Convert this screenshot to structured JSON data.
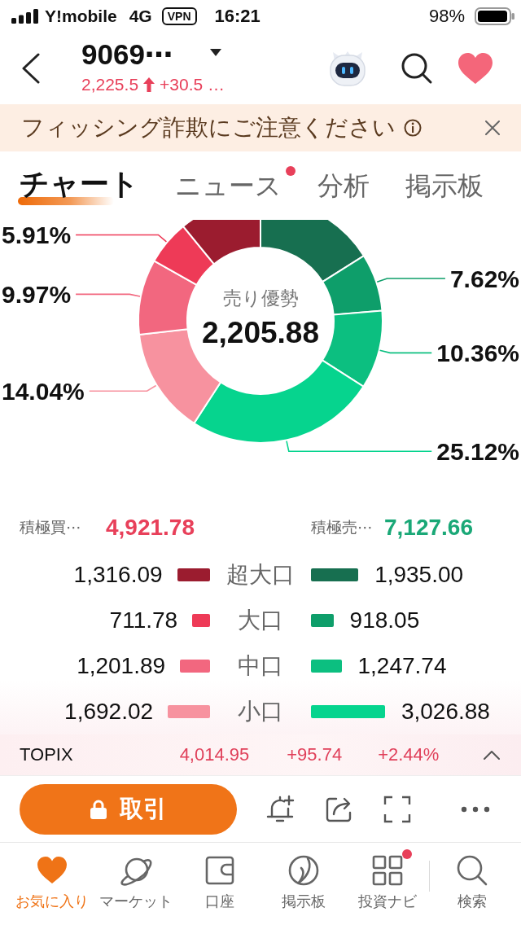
{
  "status_bar": {
    "carrier": "Y!mobile",
    "network": "4G",
    "vpn": "VPN",
    "time": "16:21",
    "battery": "98%"
  },
  "header": {
    "title": "9069⋯",
    "price": "2,225.5",
    "change": "+30.5 …"
  },
  "notice": {
    "text": "フィッシング詐欺にご注意ください"
  },
  "tabs": [
    {
      "label": "チャート",
      "selected": true,
      "dot": false
    },
    {
      "label": "ニュース",
      "selected": false,
      "dot": true
    },
    {
      "label": "分析",
      "selected": false,
      "dot": false
    },
    {
      "label": "掲示板",
      "selected": false,
      "dot": false
    }
  ],
  "chart": {
    "center_title": "売り優勢",
    "center_value": "2,205.88",
    "chart_data": {
      "type": "donut",
      "values": [
        16.06,
        7.62,
        10.36,
        25.12,
        14.04,
        9.97,
        5.91,
        10.92
      ],
      "value_labels": [
        null,
        "7.62%",
        "10.36%",
        "25.12%",
        "14.04%",
        "9.97%",
        "5.91%",
        null
      ]
    }
  },
  "summary": {
    "buy": {
      "label": "積極買⋯",
      "value": "4,921.78"
    },
    "sell": {
      "label": "積極売⋯",
      "value": "7,127.66"
    }
  },
  "flows": [
    {
      "label": "超大口",
      "buy": {
        "value": "1,316.09",
        "color": "#9b1c2f"
      },
      "sell": {
        "value": "1,935.00",
        "color": "#176f50"
      }
    },
    {
      "label": "大口",
      "buy": {
        "value": "711.78",
        "color": "#ee3a57"
      },
      "sell": {
        "value": "918.05",
        "color": "#0e9e6a"
      }
    },
    {
      "label": "中口",
      "buy": {
        "value": "1,201.89",
        "color": "#f2677f"
      },
      "sell": {
        "value": "1,247.74",
        "color": "#0cbf80"
      }
    },
    {
      "label": "小口",
      "buy": {
        "value": "1,692.02",
        "color": "#f7929f"
      },
      "sell": {
        "value": "3,026.88",
        "color": "#06d48e"
      }
    }
  ],
  "index_ticker": {
    "name": "TOPIX",
    "value": "4,014.95",
    "change": "+95.74",
    "percent": "+2.44%"
  },
  "actions": {
    "trade": "取引"
  },
  "nav": [
    {
      "label": "お気に入り",
      "selected": true,
      "dot": false
    },
    {
      "label": "マーケット",
      "selected": false,
      "dot": false
    },
    {
      "label": "口座",
      "selected": false,
      "dot": false
    },
    {
      "label": "掲示板",
      "selected": false,
      "dot": false
    },
    {
      "label": "投資ナビ",
      "selected": false,
      "dot": true
    },
    {
      "label": "検索",
      "selected": false,
      "dot": false
    }
  ]
}
